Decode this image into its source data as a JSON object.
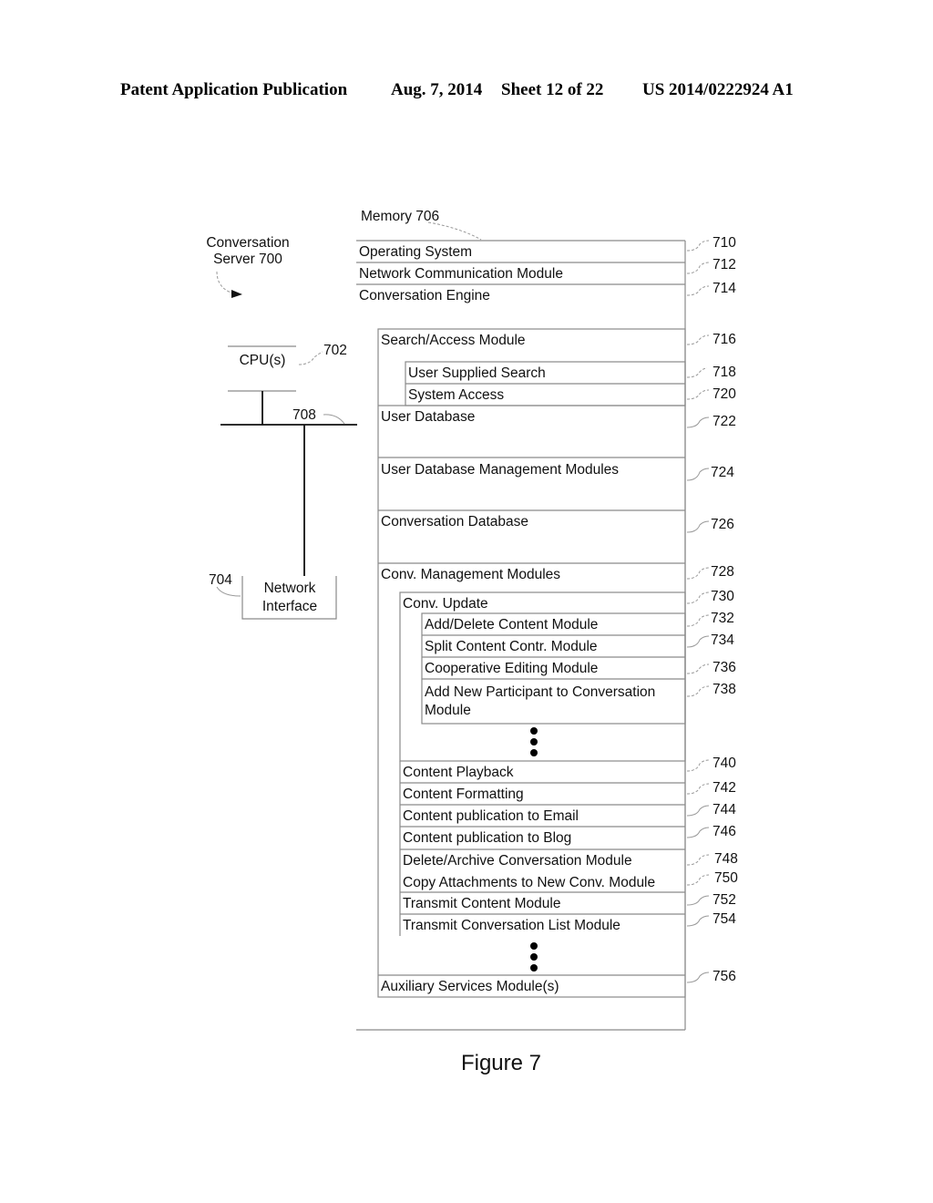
{
  "header": {
    "publication": "Patent Application Publication",
    "date": "Aug. 7, 2014",
    "sheet": "Sheet 12 of 22",
    "number": "US 2014/0222924 A1"
  },
  "diagram": {
    "server_label_line1": "Conversation",
    "server_label_line2": "Server 700",
    "memory_label": "Memory 706",
    "cpu_label": "CPU(s)",
    "cpu_ref": "702",
    "bus_ref": "708",
    "network_interface_ref": "704",
    "network_interface_line1": "Network",
    "network_interface_line2": "Interface",
    "memory_rows": [
      {
        "label": "Operating System",
        "ref": "710"
      },
      {
        "label": "Network Communication Module",
        "ref": "712"
      },
      {
        "label": "Conversation Engine",
        "ref": "714"
      }
    ],
    "engine_modules": {
      "search_access": {
        "label": "Search/Access Module",
        "ref": "716"
      },
      "user_supplied_search": {
        "label": "User Supplied Search",
        "ref": "718"
      },
      "system_access": {
        "label": "System Access",
        "ref": "720"
      },
      "user_database": {
        "label": "User Database",
        "ref": "722"
      },
      "user_db_mgmt": {
        "label": "User Database Management Modules",
        "ref": "724"
      },
      "conversation_database": {
        "label": "Conversation Database",
        "ref": "726"
      },
      "conv_mgmt": {
        "label": "Conv. Management Modules",
        "ref": "728"
      },
      "conv_update": {
        "label": "Conv. Update",
        "ref": "730"
      },
      "add_delete": {
        "label": "Add/Delete Content Module",
        "ref": "732"
      },
      "split_content": {
        "label": "Split Content Contr. Module",
        "ref": "734"
      },
      "coop_editing": {
        "label": "Cooperative Editing Module",
        "ref": "736"
      },
      "add_participant_line1": "Add New Participant to Conversation",
      "add_participant_line2": "Module",
      "add_participant_ref": "738",
      "content_playback": {
        "label": "Content Playback",
        "ref": "740"
      },
      "content_formatting": {
        "label": "Content Formatting",
        "ref": "742"
      },
      "pub_email": {
        "label": "Content publication to Email",
        "ref": "744"
      },
      "pub_blog": {
        "label": "Content publication to Blog",
        "ref": "746"
      },
      "delete_archive": {
        "label": "Delete/Archive Conversation Module",
        "ref": "748"
      },
      "copy_attachments": {
        "label": "Copy Attachments to New Conv. Module",
        "ref": "750"
      },
      "transmit_content": {
        "label": "Transmit Content Module",
        "ref": "752"
      },
      "transmit_list": {
        "label": "Transmit Conversation List Module",
        "ref": "754"
      },
      "auxiliary": {
        "label": "Auxiliary Services Module(s)",
        "ref": "756"
      }
    },
    "figure_caption": "Figure 7"
  }
}
